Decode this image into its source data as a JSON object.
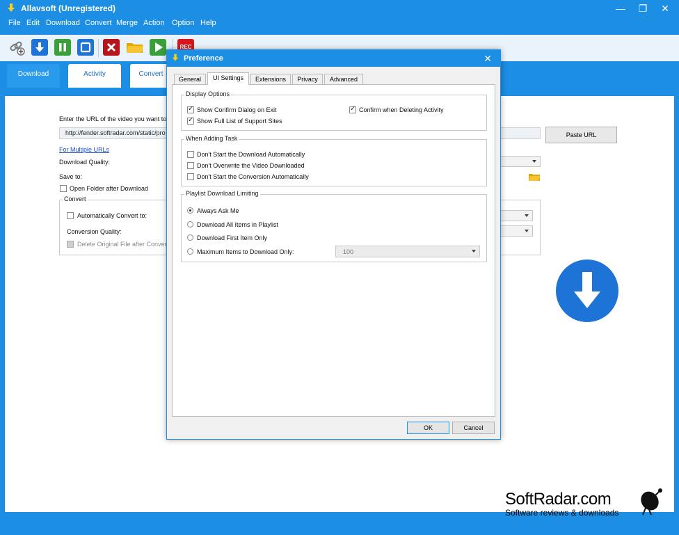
{
  "window": {
    "title": "Allavsoft (Unregistered)",
    "minimize": "—",
    "maximize": "❐",
    "close": "✕"
  },
  "menu": [
    "File",
    "Edit",
    "Download",
    "Convert",
    "Merge",
    "Action",
    "Option",
    "Help"
  ],
  "toolbar": {
    "icons": [
      "paste-link-icon",
      "download-icon",
      "pause-icon",
      "stop-icon",
      "delete-icon",
      "folder-icon",
      "play-icon",
      "rec-icon"
    ],
    "rec_label": "REC"
  },
  "main_tabs": [
    "Download",
    "Activity",
    "Convert"
  ],
  "download_panel": {
    "url_prompt": "Enter the URL of the video you want to",
    "url_value": "http://fender.softradar.com/static/pro",
    "paste_url": "Paste URL",
    "multiple_urls": "For Multiple URLs",
    "download_quality": "Download Quality:",
    "save_to": "Save to:",
    "open_folder": "Open Folder after Download",
    "convert_group": "Convert",
    "auto_convert": "Automatically Convert to:",
    "conversion_quality": "Conversion Quality:",
    "delete_original": "Delete Original File after Conversi"
  },
  "dialog": {
    "title": "Preference",
    "close": "✕",
    "tabs": [
      "General",
      "UI Settings",
      "Extensions",
      "Privacy",
      "Advanced"
    ],
    "active_tab": "UI Settings",
    "display_options": {
      "title": "Display Options",
      "show_confirm_exit": "Show Confirm Dialog on Exit",
      "show_full_list": "Show Full List of Support Sites",
      "confirm_deleting": "Confirm when Deleting Activity"
    },
    "when_adding": {
      "title": "When Adding Task",
      "dont_start_download": "Don't Start the Download Automatically",
      "dont_overwrite": "Don't Overwrite the Video Downloaded",
      "dont_start_conversion": "Don't Start the Conversion Automatically"
    },
    "playlist": {
      "title": "Playlist Download Limiting",
      "always_ask": "Always Ask Me",
      "download_all": "Download All Items in Playlist",
      "download_first": "Download First Item Only",
      "maximum_items": "Maximum Items to Download Only:",
      "max_value": "100"
    },
    "ok": "OK",
    "cancel": "Cancel"
  },
  "watermark": {
    "title": "SoftRadar.com",
    "subtitle": "Software reviews & downloads"
  },
  "colors": {
    "brand_blue": "#1c8ee3",
    "download_blue": "#1e74d6"
  }
}
